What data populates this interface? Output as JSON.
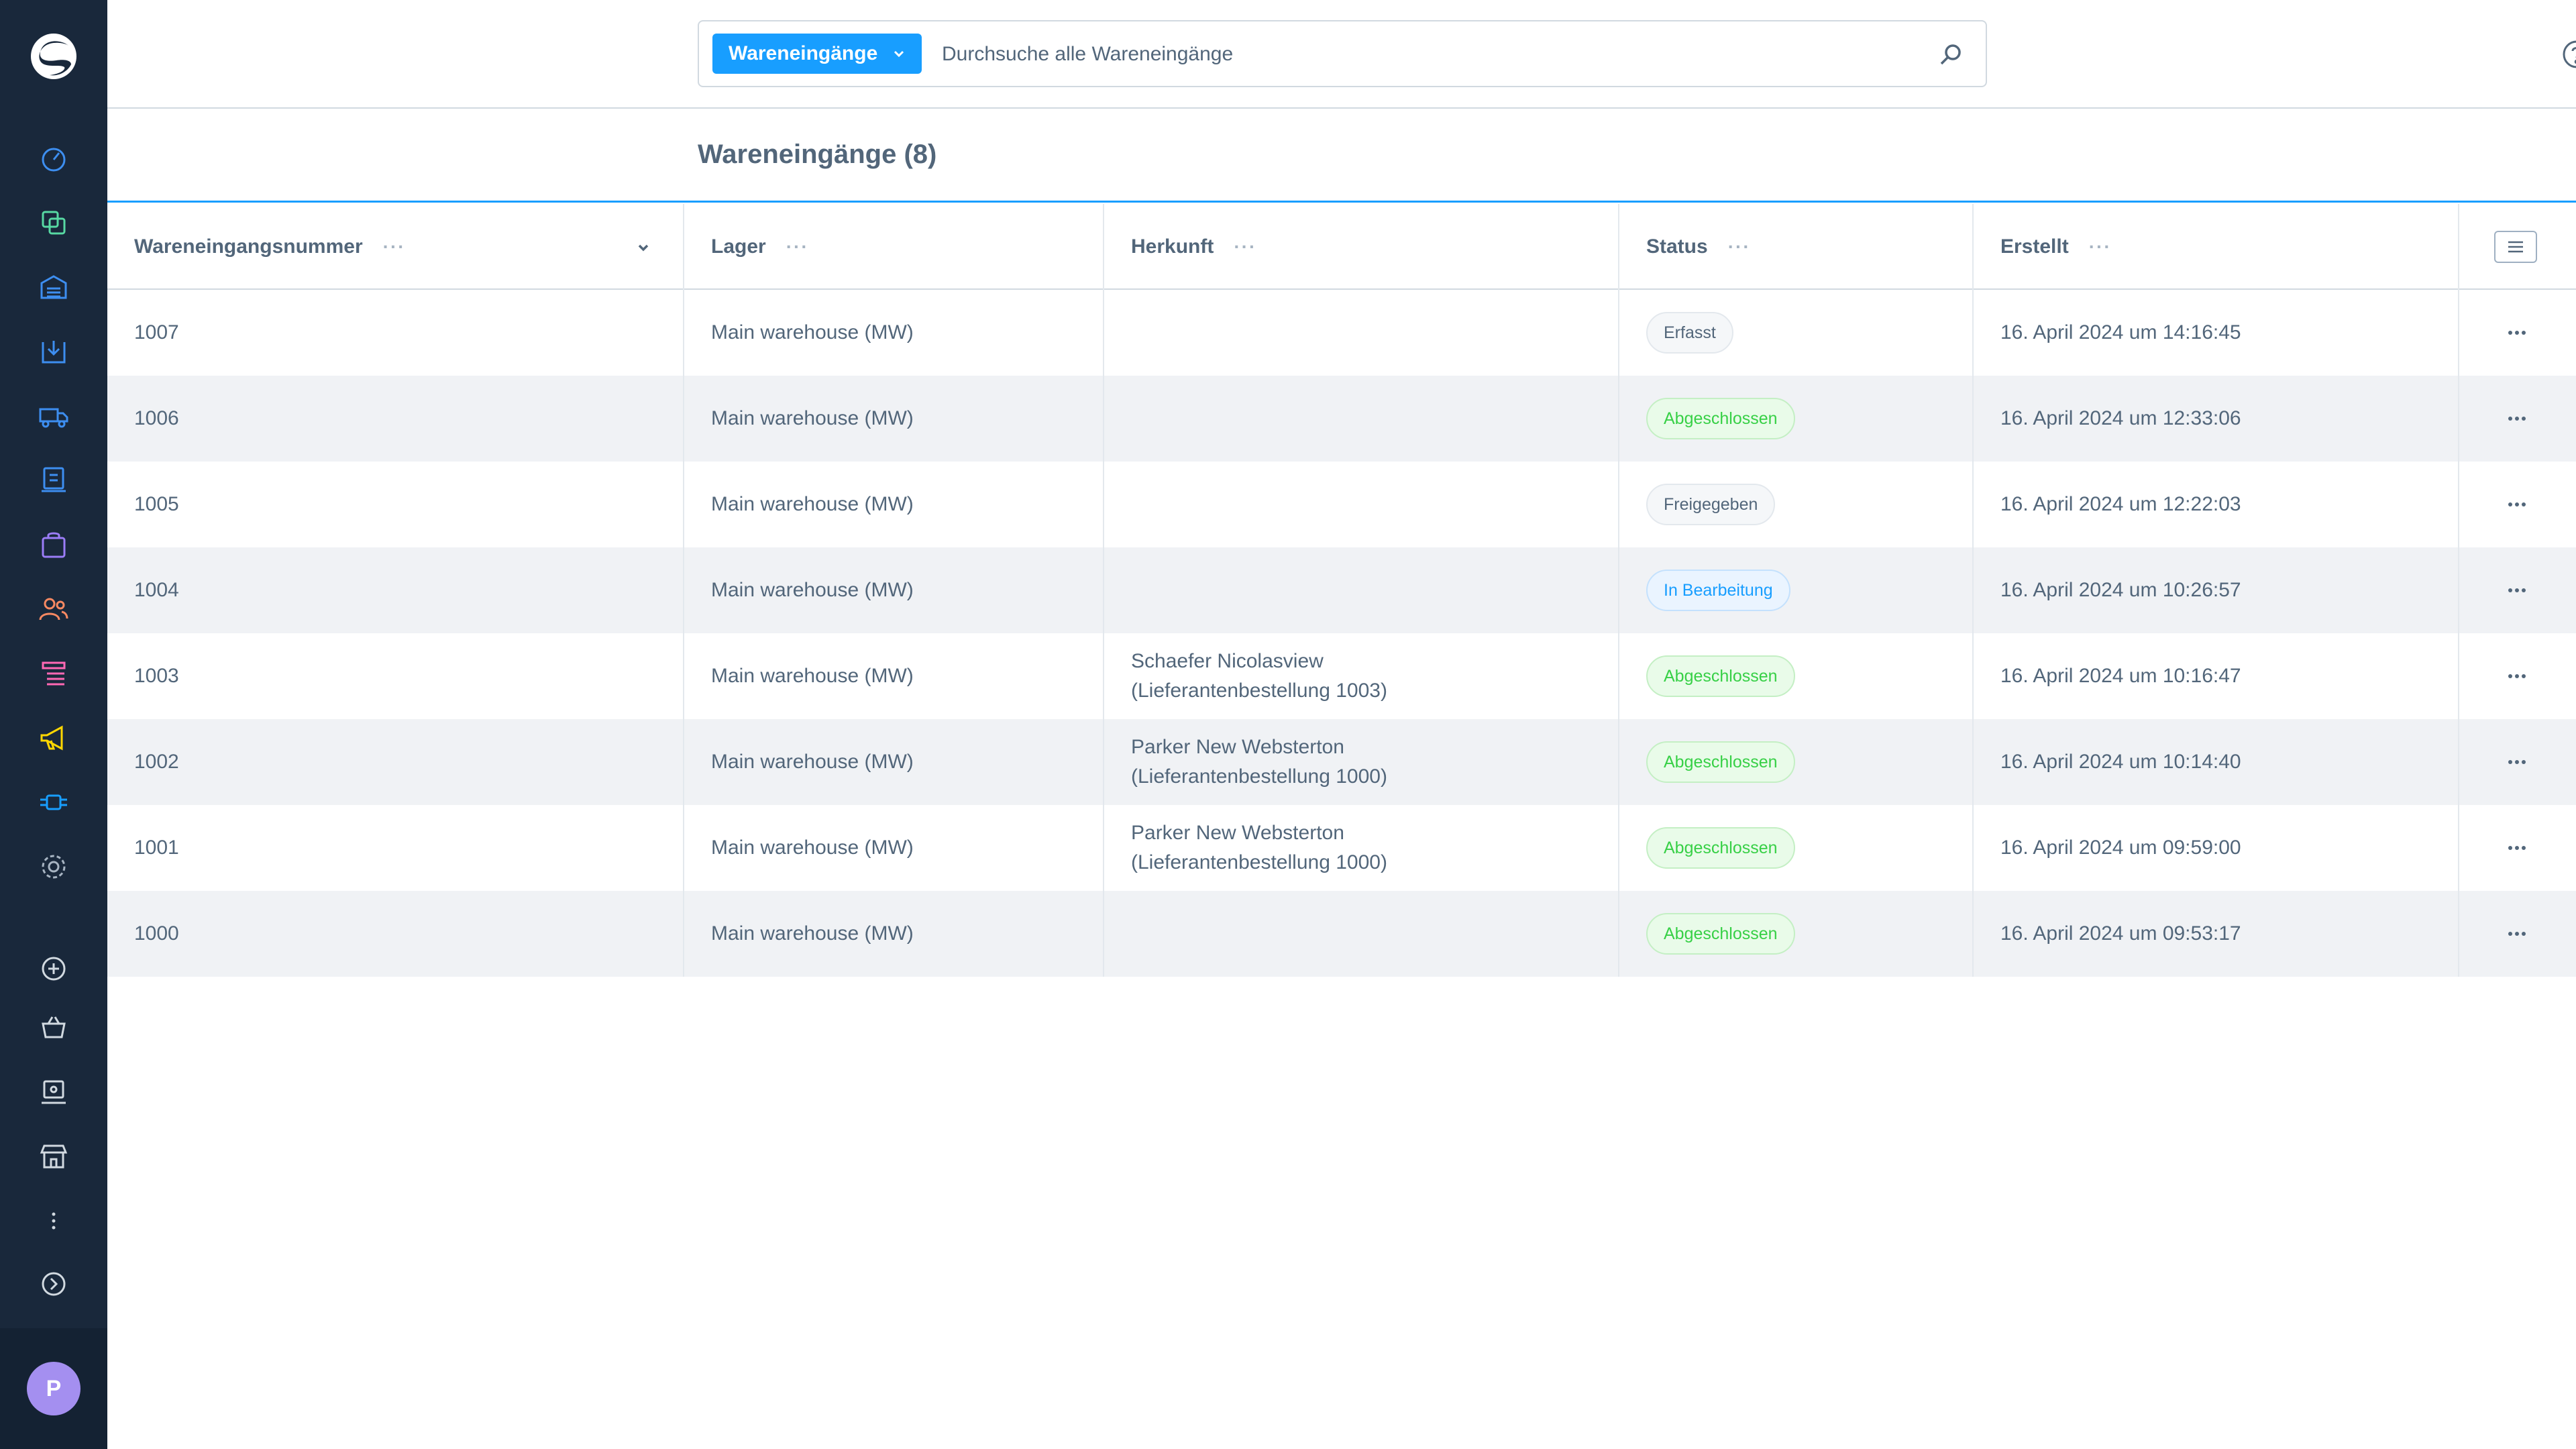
{
  "header": {
    "search_type_label": "Wareneingänge",
    "search_placeholder": "Durchsuche alle Wareneingänge"
  },
  "page": {
    "title": "Wareneingänge (8)"
  },
  "table": {
    "columns": [
      "Wareneingangsnummer",
      "Lager",
      "Herkunft",
      "Status",
      "Erstellt"
    ],
    "rows": [
      {
        "number": "1007",
        "warehouse": "Main warehouse (MW)",
        "origin_line1": "",
        "origin_line2": "",
        "status": "Erfasst",
        "status_type": "default",
        "created": "16. April 2024 um 14:16:45"
      },
      {
        "number": "1006",
        "warehouse": "Main warehouse (MW)",
        "origin_line1": "",
        "origin_line2": "",
        "status": "Abgeschlossen",
        "status_type": "success",
        "created": "16. April 2024 um 12:33:06"
      },
      {
        "number": "1005",
        "warehouse": "Main warehouse (MW)",
        "origin_line1": "",
        "origin_line2": "",
        "status": "Freigegeben",
        "status_type": "default",
        "created": "16. April 2024 um 12:22:03"
      },
      {
        "number": "1004",
        "warehouse": "Main warehouse (MW)",
        "origin_line1": "",
        "origin_line2": "",
        "status": "In Bearbeitung",
        "status_type": "info",
        "created": "16. April 2024 um 10:26:57"
      },
      {
        "number": "1003",
        "warehouse": "Main warehouse (MW)",
        "origin_line1": "Schaefer Nicolasview",
        "origin_line2": "(Lieferantenbestellung 1003)",
        "status": "Abgeschlossen",
        "status_type": "success",
        "created": "16. April 2024 um 10:16:47"
      },
      {
        "number": "1002",
        "warehouse": "Main warehouse (MW)",
        "origin_line1": "Parker New Websterton",
        "origin_line2": "(Lieferantenbestellung 1000)",
        "status": "Abgeschlossen",
        "status_type": "success",
        "created": "16. April 2024 um 10:14:40"
      },
      {
        "number": "1001",
        "warehouse": "Main warehouse (MW)",
        "origin_line1": "Parker New Websterton",
        "origin_line2": "(Lieferantenbestellung 1000)",
        "status": "Abgeschlossen",
        "status_type": "success",
        "created": "16. April 2024 um 09:59:00"
      },
      {
        "number": "1000",
        "warehouse": "Main warehouse (MW)",
        "origin_line1": "",
        "origin_line2": "",
        "status": "Abgeschlossen",
        "status_type": "success",
        "created": "16. April 2024 um 09:53:17"
      }
    ]
  },
  "user": {
    "avatar_initial": "P"
  },
  "colors": {
    "sidebar_bg": "#19283b",
    "accent": "#189eff",
    "success": "#37d046",
    "notification_dot": "#de294c"
  },
  "icons": {
    "sidebar": [
      "dashboard-icon",
      "catalogue-icon",
      "warehouse-icon",
      "goods-receipt-icon",
      "shipping-icon",
      "orders-icon",
      "shopping-bag-icon",
      "customers-icon",
      "content-icon",
      "marketing-icon",
      "extensions-icon",
      "settings-icon",
      "add-sales-channel-icon",
      "storefront-basket-icon",
      "pos-icon",
      "store-icon",
      "more-icon",
      "expand-icon"
    ]
  }
}
